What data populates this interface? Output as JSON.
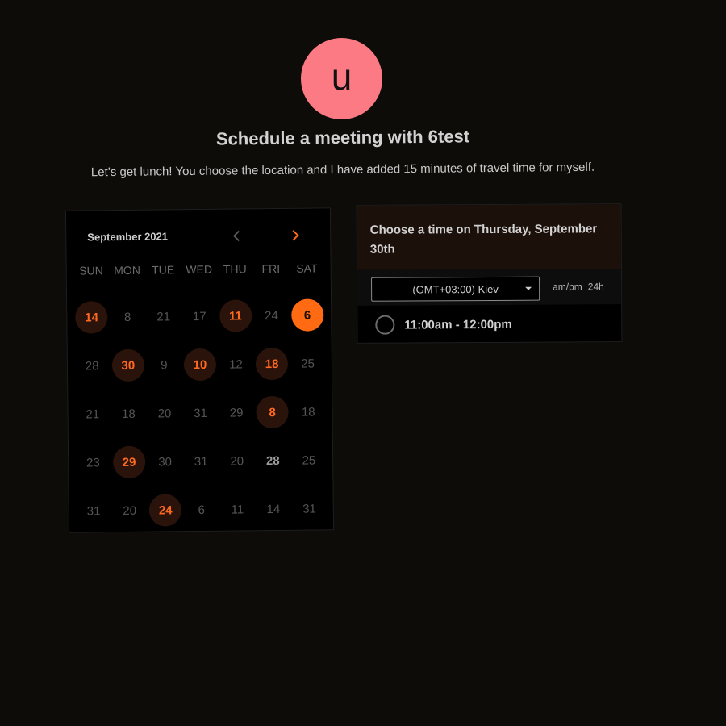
{
  "host": {
    "avatar_initial": "u",
    "title": "Schedule a meeting with 6test",
    "description": "Let’s get lunch! You choose the location and I have added 15 minutes of travel time for myself."
  },
  "calendar": {
    "month_label": "September 2021",
    "prev_icon": "chevron-left-icon",
    "next_icon": "chevron-right-icon",
    "weekdays": [
      "SUN",
      "MON",
      "TUE",
      "WED",
      "THU",
      "FRI",
      "SAT"
    ],
    "weeks": [
      [
        {
          "d": "14",
          "s": "avail"
        },
        {
          "d": "8",
          "s": "off"
        },
        {
          "d": "21",
          "s": "off"
        },
        {
          "d": "17",
          "s": "off"
        },
        {
          "d": "11",
          "s": "avail"
        },
        {
          "d": "24",
          "s": "off"
        },
        {
          "d": "6",
          "s": "selected"
        }
      ],
      [
        {
          "d": "28",
          "s": "off"
        },
        {
          "d": "30",
          "s": "avail"
        },
        {
          "d": "9",
          "s": "off"
        },
        {
          "d": "10",
          "s": "avail"
        },
        {
          "d": "12",
          "s": "off"
        },
        {
          "d": "18",
          "s": "avail"
        },
        {
          "d": "25",
          "s": "off"
        }
      ],
      [
        {
          "d": "21",
          "s": "off"
        },
        {
          "d": "18",
          "s": "off"
        },
        {
          "d": "20",
          "s": "off"
        },
        {
          "d": "31",
          "s": "off"
        },
        {
          "d": "29",
          "s": "off"
        },
        {
          "d": "8",
          "s": "avail"
        },
        {
          "d": "18",
          "s": "off"
        }
      ],
      [
        {
          "d": "23",
          "s": "off"
        },
        {
          "d": "29",
          "s": "avail"
        },
        {
          "d": "30",
          "s": "off"
        },
        {
          "d": "31",
          "s": "off"
        },
        {
          "d": "20",
          "s": "off"
        },
        {
          "d": "28",
          "s": "bright"
        },
        {
          "d": "25",
          "s": "off"
        }
      ],
      [
        {
          "d": "31",
          "s": "off"
        },
        {
          "d": "20",
          "s": "off"
        },
        {
          "d": "24",
          "s": "avail"
        },
        {
          "d": "6",
          "s": "off"
        },
        {
          "d": "11",
          "s": "off"
        },
        {
          "d": "14",
          "s": "off"
        },
        {
          "d": "31",
          "s": "off"
        }
      ]
    ]
  },
  "times": {
    "header": "Choose a time on Thursday, September 30th",
    "timezone_value": "(GMT+03:00) Kiev",
    "format_ampm": "am/pm",
    "format_24h": "24h",
    "slots": [
      "11:00am - 12:00pm"
    ]
  },
  "colors": {
    "accent": "#ff6a13",
    "avatar": "#fb7a84",
    "background": "#0e0c09"
  }
}
